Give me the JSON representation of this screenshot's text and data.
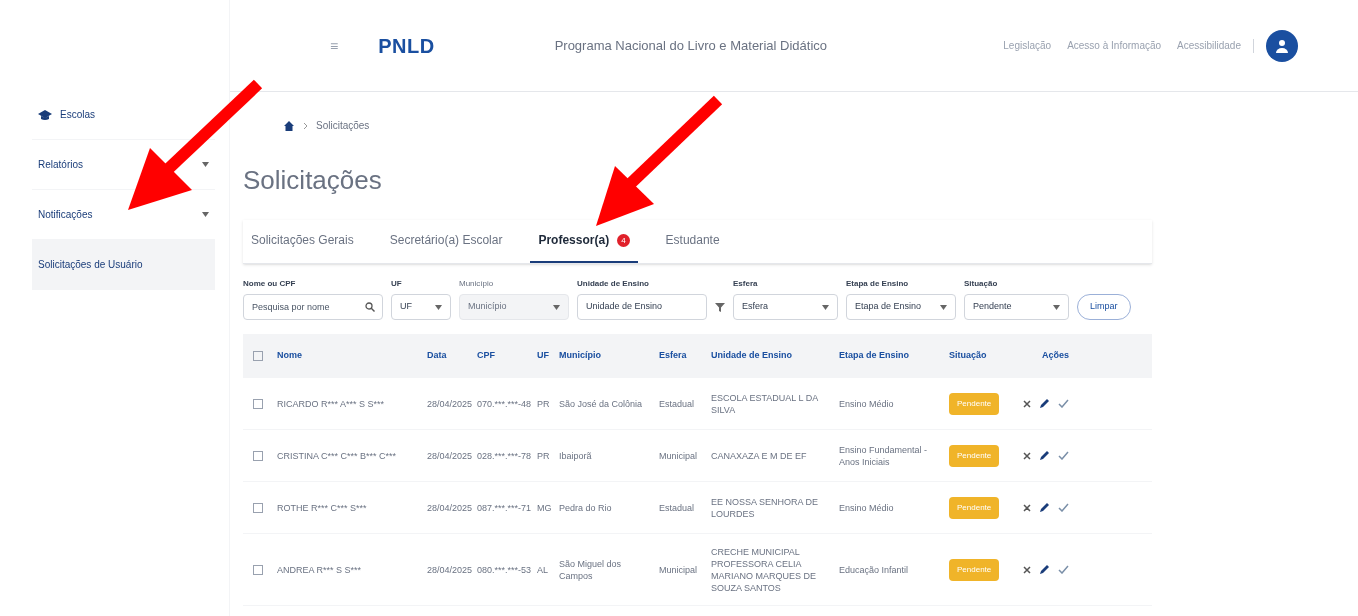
{
  "header": {
    "menu_icon": "≡",
    "logo": "PNLD",
    "title": "Programa Nacional do Livro e Material Didático",
    "links": [
      "Legislação",
      "Acesso à Informação",
      "Acessibilidade"
    ]
  },
  "sidebar": {
    "items": [
      {
        "label": "Escolas",
        "kind": "icon",
        "selected": false
      },
      {
        "label": "Relatórios",
        "kind": "expand",
        "selected": false
      },
      {
        "label": "Notificações",
        "kind": "expand",
        "selected": false
      },
      {
        "label": "Solicitações de Usuário",
        "kind": "plain",
        "selected": true
      }
    ]
  },
  "breadcrumb": [
    "Solicitações"
  ],
  "page_title": "Solicitações",
  "tabs": [
    {
      "label": "Solicitações Gerais",
      "selected": false
    },
    {
      "label": "Secretário(a) Escolar",
      "selected": false
    },
    {
      "label": "Professor(a)",
      "selected": true,
      "badge": "4"
    },
    {
      "label": "Estudante",
      "selected": false
    }
  ],
  "filters": [
    {
      "label": "Nome ou CPF",
      "kind": "search",
      "placeholder": "Pesquisa por nome",
      "disabled": false
    },
    {
      "label": "UF",
      "kind": "select",
      "value": "UF",
      "disabled": false
    },
    {
      "label": "Município",
      "kind": "select",
      "value": "Município",
      "disabled": true
    },
    {
      "label": "Unidade de Ensino",
      "kind": "text",
      "value": "Unidade de Ensino",
      "disabled": false
    },
    {
      "label": "Esfera",
      "kind": "select",
      "value": "Esfera",
      "disabled": false
    },
    {
      "label": "Etapa de Ensino",
      "kind": "select",
      "value": "Etapa de Ensino",
      "disabled": false
    },
    {
      "label": "Situação",
      "kind": "select",
      "value": "Pendente",
      "disabled": false
    }
  ],
  "clear_button": "Limpar",
  "table": {
    "select_all_checked": false,
    "columns": [
      "Nome",
      "Data",
      "CPF",
      "UF",
      "Município",
      "Esfera",
      "Unidade de Ensino",
      "Etapa de Ensino",
      "Situação",
      "Ações"
    ],
    "rows": [
      {
        "checked": false,
        "cells": [
          "RICARDO R*** A*** S S***",
          "28/04/2025",
          "070.***.***-48",
          "PR",
          "São José da Colônia",
          "Estadual",
          "ESCOLA ESTADUAL L DA SILVA",
          "Ensino Médio"
        ],
        "status": "Pendente"
      },
      {
        "checked": false,
        "cells": [
          "CRISTINA C*** C*** B*** C***",
          "28/04/2025",
          "028.***.***-78",
          "PR",
          "Ibaiporã",
          "Municipal",
          "CANAXAZA E M DE EF",
          "Ensino Fundamental - Anos Iniciais"
        ],
        "status": "Pendente"
      },
      {
        "checked": false,
        "cells": [
          "ROTHE R*** C*** S***",
          "28/04/2025",
          "087.***.***-71",
          "MG",
          "Pedra do Rio",
          "Estadual",
          "EE NOSSA SENHORA DE LOURDES",
          "Ensino Médio"
        ],
        "status": "Pendente"
      },
      {
        "checked": false,
        "cells": [
          "ANDREA R*** S S***",
          "28/04/2025",
          "080.***.***-53",
          "AL",
          "São Miguel dos Campos",
          "Municipal",
          "CRECHE MUNICIPAL PROFESSORA CELIA MARIANO MARQUES DE SOUZA SANTOS",
          "Educação Infantil"
        ],
        "status": "Pendente"
      }
    ]
  }
}
